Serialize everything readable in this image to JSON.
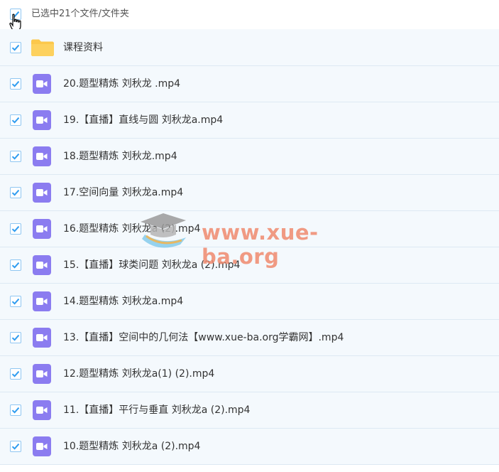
{
  "header": {
    "select_label": "已选中21个文件/文件夹"
  },
  "items": [
    {
      "type": "folder",
      "name": "课程资料"
    },
    {
      "type": "video",
      "name": "20.题型精炼 刘秋龙 .mp4"
    },
    {
      "type": "video",
      "name": "19.【直播】直线与圆 刘秋龙a.mp4"
    },
    {
      "type": "video",
      "name": "18.题型精炼 刘秋龙.mp4"
    },
    {
      "type": "video",
      "name": "17.空间向量 刘秋龙a.mp4"
    },
    {
      "type": "video",
      "name": "16.题型精炼 刘秋龙a (2).mp4"
    },
    {
      "type": "video",
      "name": "15.【直播】球类问题 刘秋龙a (2).mp4"
    },
    {
      "type": "video",
      "name": "14.题型精炼 刘秋龙a.mp4"
    },
    {
      "type": "video",
      "name": "13.【直播】空间中的几何法【www.xue-ba.org学霸网】.mp4"
    },
    {
      "type": "video",
      "name": "12.题型精炼 刘秋龙a(1) (2).mp4"
    },
    {
      "type": "video",
      "name": "11.【直播】平行与垂直 刘秋龙a (2).mp4"
    },
    {
      "type": "video",
      "name": "10.题型精炼 刘秋龙a (2).mp4"
    }
  ],
  "watermark": {
    "text": "www.xue-ba.org"
  },
  "colors": {
    "check": "#2f9cf0",
    "video_icon": "#8b7cf0",
    "folder": "#fcc84b",
    "row_bg": "#f4f9fd"
  }
}
